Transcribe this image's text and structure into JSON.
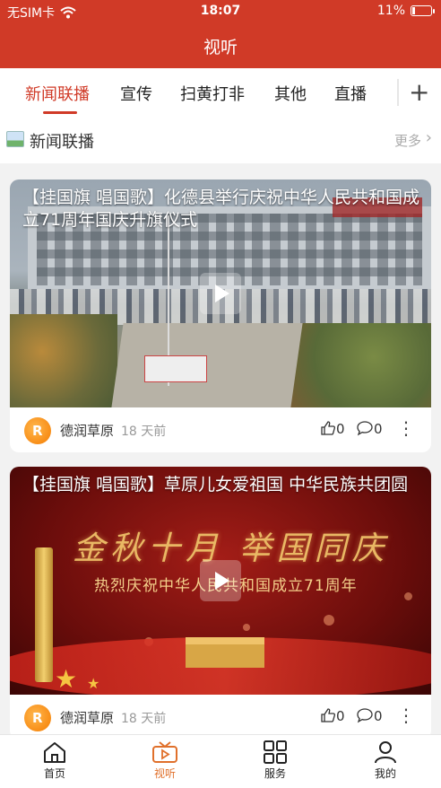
{
  "status_bar": {
    "carrier": "无SIM卡",
    "time": "18:07",
    "battery": "11%"
  },
  "header": {
    "title": "视听"
  },
  "tabs": [
    {
      "label": "新闻联播",
      "active": true
    },
    {
      "label": "宣传",
      "active": false
    },
    {
      "label": "扫黄打非",
      "active": false
    },
    {
      "label": "其他",
      "active": false
    },
    {
      "label": "直播",
      "active": false
    }
  ],
  "section": {
    "title": "新闻联播",
    "more": "更多"
  },
  "cards": [
    {
      "caption": "【挂国旗 唱国歌】化德县举行庆祝中华人民共和国成立71周年国庆升旗仪式",
      "author": "德润草原",
      "ago": "18 天前",
      "likes": "0",
      "comments": "0"
    },
    {
      "caption": "【挂国旗 唱国歌】草原儿女爱祖国 中华民族共团圆",
      "author": "德润草原",
      "ago": "18 天前",
      "likes": "0",
      "comments": "0",
      "overlay_title": "金秋十月 举国同庆",
      "overlay_sub": "热烈庆祝中华人民共和国成立71周年"
    }
  ],
  "tabbar": [
    {
      "label": "首页",
      "icon": "home-icon",
      "active": false
    },
    {
      "label": "视听",
      "icon": "tv-icon",
      "active": true
    },
    {
      "label": "服务",
      "icon": "grid-icon",
      "active": false
    },
    {
      "label": "我的",
      "icon": "user-icon",
      "active": false
    }
  ],
  "colors": {
    "brand": "#d03a27",
    "tab_active": "#e0702b"
  }
}
